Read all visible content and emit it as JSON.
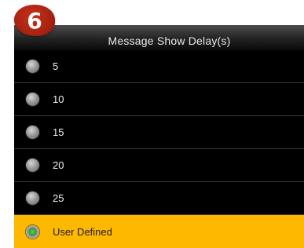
{
  "step_badge": "6",
  "header": {
    "title": "Message Show Delay(s)"
  },
  "options": [
    {
      "label": "5",
      "selected": false
    },
    {
      "label": "10",
      "selected": false
    },
    {
      "label": "15",
      "selected": false
    },
    {
      "label": "20",
      "selected": false
    },
    {
      "label": "25",
      "selected": false
    },
    {
      "label": "User Defined",
      "selected": true
    }
  ],
  "colors": {
    "background": "#000000",
    "selected_row": "#ffb800",
    "badge": "#b3260f",
    "selected_radio": "#3cb83a"
  },
  "icons": {
    "radio_unselected": "radio-button-grey",
    "radio_selected": "radio-button-green"
  }
}
